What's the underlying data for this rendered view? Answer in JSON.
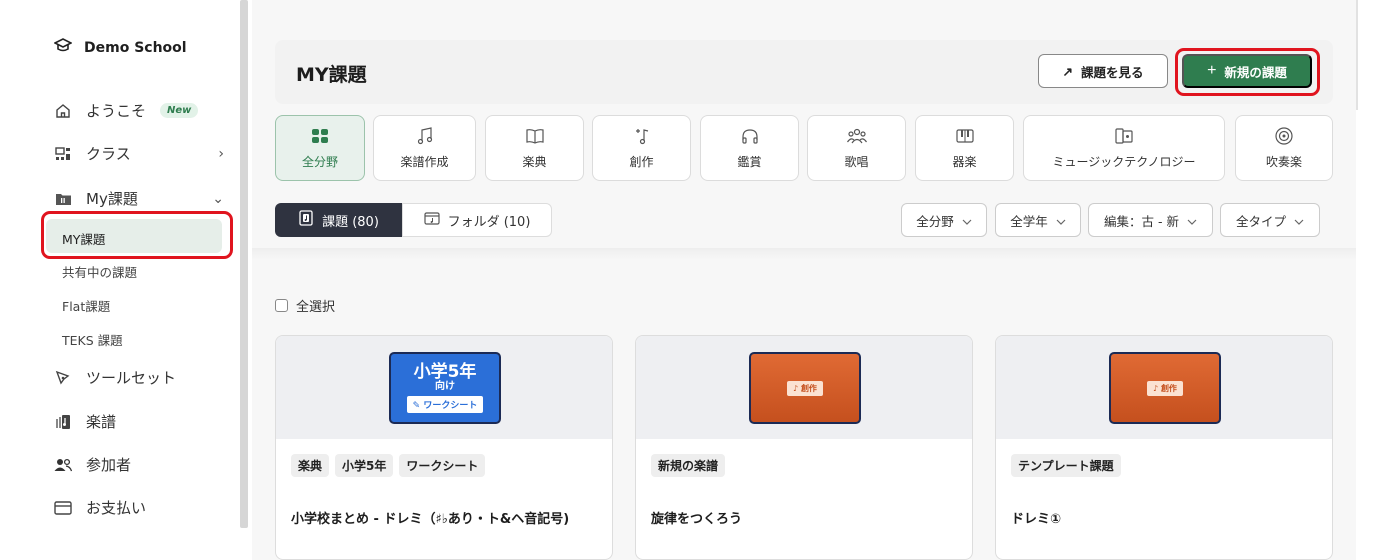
{
  "sidebar": {
    "school": "Demo School",
    "items": [
      {
        "label": "ようこそ",
        "badge": "New",
        "icon": "home-icon"
      },
      {
        "label": "クラス",
        "icon": "class-icon",
        "chevron": "›"
      },
      {
        "label": "My課題",
        "icon": "folder-icon",
        "chevron": "⌄"
      }
    ],
    "sub_items": [
      {
        "label": "MY課題",
        "active": true
      },
      {
        "label": "共有中の課題"
      },
      {
        "label": "Flat課題"
      },
      {
        "label": "TEKS 課題"
      }
    ],
    "bottom_items": [
      {
        "label": "ツールセット",
        "icon": "pen-tool-icon"
      },
      {
        "label": "楽譜",
        "icon": "score-icon"
      },
      {
        "label": "参加者",
        "icon": "users-icon"
      },
      {
        "label": "お支払い",
        "icon": "card-icon"
      }
    ]
  },
  "header": {
    "title": "MY課題",
    "view_button": "課題を見る",
    "view_icon": "↗",
    "new_button": "新規の課題",
    "new_icon": "+"
  },
  "categories": [
    {
      "label": "全分野",
      "icon": "grid-icon",
      "active": true
    },
    {
      "label": "楽譜作成",
      "icon": "music-note-icon"
    },
    {
      "label": "楽典",
      "icon": "book-icon"
    },
    {
      "label": "創作",
      "icon": "compose-icon"
    },
    {
      "label": "鑑賞",
      "icon": "headphones-icon"
    },
    {
      "label": "歌唱",
      "icon": "singers-icon"
    },
    {
      "label": "器楽",
      "icon": "piano-icon"
    },
    {
      "label": "ミュージックテクノロジー",
      "icon": "device-icon"
    },
    {
      "label": "吹奏楽",
      "icon": "speaker-icon"
    }
  ],
  "tabs": {
    "assignments": "課題 (80)",
    "folders": "フォルダ (10)"
  },
  "filters": [
    {
      "label": "全分野"
    },
    {
      "label": "全学年"
    },
    {
      "label": "編集：古 - 新"
    },
    {
      "label": "全タイプ"
    }
  ],
  "select_all": "全選択",
  "cards": [
    {
      "thumb_big": "小学5年",
      "thumb_small": "向け",
      "thumb_tag": "ワークシート",
      "tags": [
        "楽典",
        "小学5年",
        "ワークシート"
      ],
      "title": "小学校まとめ - ドレミ（♯♭あり・ト&ヘ音記号)"
    },
    {
      "thumb_tag": "♪ 創作",
      "tags": [
        "新規の楽譜"
      ],
      "title": "旋律をつくろう"
    },
    {
      "thumb_tag": "♪ 創作",
      "tags": [
        "テンプレート課題"
      ],
      "title": "ドレミ①"
    }
  ],
  "colors": {
    "accent": "#2f7d4f",
    "highlight": "#e0141e",
    "dark_tab": "#2f3340"
  }
}
